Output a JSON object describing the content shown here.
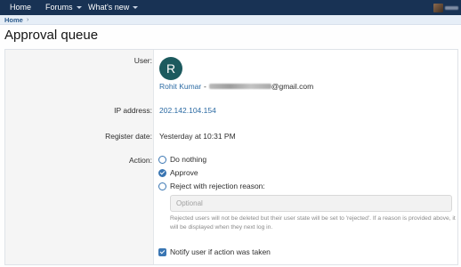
{
  "nav": {
    "home": "Home",
    "forums": "Forums",
    "whats_new": "What's new"
  },
  "breadcrumb": {
    "home": "Home",
    "separator": "›"
  },
  "page": {
    "title": "Approval queue"
  },
  "user_entry": {
    "labels": {
      "user": "User:",
      "ip": "IP address:",
      "register": "Register date:",
      "action": "Action:"
    },
    "avatar_letter": "R",
    "username": "Rohit Kumar",
    "email_separator": "-",
    "email_domain": "@gmail.com",
    "ip_address": "202.142.104.154",
    "register_date": "Yesterday at 10:31 PM"
  },
  "actions": {
    "options": [
      {
        "label": "Do nothing",
        "checked": false
      },
      {
        "label": "Approve",
        "checked": true
      },
      {
        "label": "Reject with rejection reason:",
        "checked": false
      }
    ],
    "reason_placeholder": "Optional",
    "hint": "Rejected users will not be deleted but their user state will be set to 'rejected'. If a reason is provided above, it will be displayed when they next log in.",
    "notify_label": "Notify user if action was taken",
    "notify_checked": true
  },
  "colors": {
    "nav_background": "#183254",
    "link": "#2b6aa3",
    "accent": "#3a76b3",
    "avatar_background": "#1c5a5e"
  },
  "icons": {
    "nav_caret": "chevron-down-icon",
    "breadcrumb_separator": "chevron-right-icon",
    "radio_selected": "check-icon",
    "checkbox_checked": "check-icon"
  }
}
